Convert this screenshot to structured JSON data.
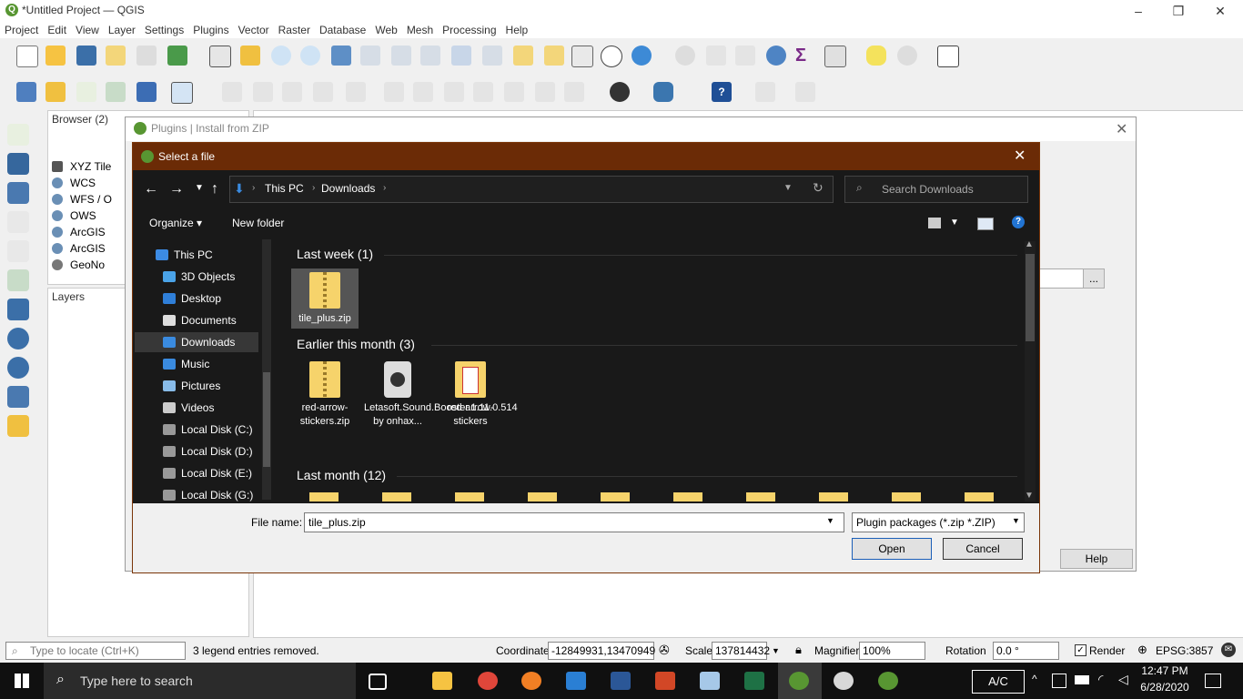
{
  "qgis": {
    "title": "*Untitled Project — QGIS",
    "menu": [
      "Project",
      "Edit",
      "View",
      "Layer",
      "Settings",
      "Plugins",
      "Vector",
      "Raster",
      "Database",
      "Web",
      "Mesh",
      "Processing",
      "Help"
    ],
    "browser_title": "Browser (2)",
    "browser_items": [
      "XYZ Tile",
      "WCS",
      "WFS / O",
      "OWS",
      "ArcGIS",
      "ArcGIS",
      "GeoNo"
    ],
    "layers_title": "Layers"
  },
  "plugins_dialog": {
    "title": "Plugins | Install from ZIP",
    "browse_label": "...",
    "help_label": "Help"
  },
  "file_dialog": {
    "title": "Select a file",
    "breadcrumb": [
      "This PC",
      "Downloads"
    ],
    "search_placeholder": "Search Downloads",
    "organize": "Organize",
    "new_folder": "New folder",
    "nav_items": [
      "This PC",
      "3D Objects",
      "Desktop",
      "Documents",
      "Downloads",
      "Music",
      "Pictures",
      "Videos",
      "Local Disk (C:)",
      "Local Disk (D:)",
      "Local Disk (E:)",
      "Local Disk (G:)"
    ],
    "groups": [
      {
        "label": "Last week (1)",
        "files": [
          "tile_plus.zip"
        ]
      },
      {
        "label": "Earlier this month (3)",
        "files": [
          "red-arrow-stickers.zip",
          "Letasoft.Sound.Booster.1.11.0.514 by onhax...",
          "red-arrow-stickers"
        ]
      },
      {
        "label": "Last month (12)",
        "files": []
      }
    ],
    "file_name_label": "File name:",
    "file_name_value": "tile_plus.zip",
    "filter": "Plugin packages (*.zip *.ZIP)",
    "open": "Open",
    "cancel": "Cancel"
  },
  "statusbar": {
    "locate_placeholder": "Type to locate (Ctrl+K)",
    "message": "3 legend entries removed.",
    "coordinate_label": "Coordinate",
    "coordinate_value": "-12849931,13470949",
    "scale_label": "Scale",
    "scale_value": "137814432",
    "magnifier_label": "Magnifier",
    "magnifier_value": "100%",
    "rotation_label": "Rotation",
    "rotation_value": "0.0 °",
    "render_label": "Render",
    "crs": "EPSG:3857"
  },
  "taskbar": {
    "search_placeholder": "Type here to search",
    "keyboard": "A/C",
    "time": "12:47 PM",
    "date": "6/28/2020"
  }
}
